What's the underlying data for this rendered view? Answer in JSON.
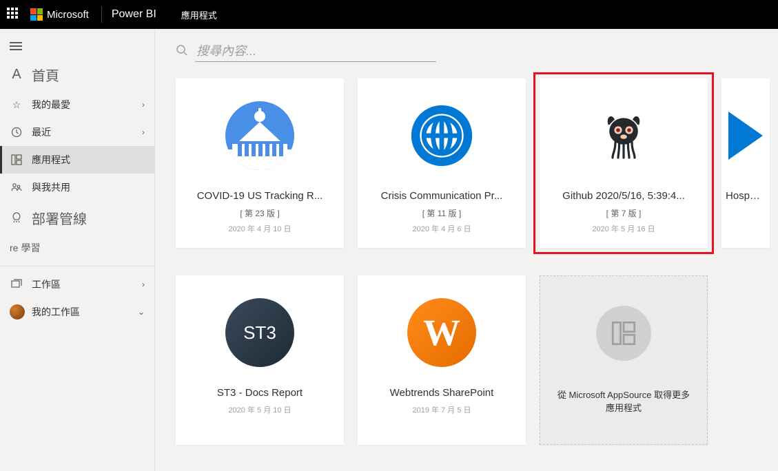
{
  "topbar": {
    "brand": "Microsoft",
    "product": "Power BI",
    "breadcrumb": "應用程式"
  },
  "sidebar": {
    "home": "首頁",
    "favorites": "我的最愛",
    "recent": "最近",
    "apps": "應用程式",
    "shared": "與我共用",
    "pipelines": "部署管線",
    "learn_prefix": "re",
    "learn": "學習",
    "workspaces": "工作區",
    "my_workspace": "我的工作區"
  },
  "search": {
    "placeholder": "搜尋內容..."
  },
  "cards": [
    {
      "title": "COVID-19 US Tracking R...",
      "version": "[ 第 23 版 ]",
      "date": "2020 年 4 月 10 日",
      "icon": "capitol"
    },
    {
      "title": "Crisis Communication Pr...",
      "version": "[ 第 11 版 ]",
      "date": "2020 年 4 月 6 日",
      "icon": "globe"
    },
    {
      "title": "Github 2020/5/16, 5:39:4...",
      "version": "[ 第 7 版 ]",
      "date": "2020 年 5 月 16 日",
      "icon": "octocat",
      "highlight": true
    },
    {
      "title": "Hospital",
      "icon": "hospital",
      "partial": true
    },
    {
      "title": "ST3 - Docs Report",
      "date": "2020 年 5 月 10 日",
      "icon": "st3"
    },
    {
      "title": "Webtrends SharePoint",
      "date": "2019 年 7 月 5 日",
      "icon": "webtrends"
    }
  ],
  "getmore": "從 Microsoft AppSource 取得更多應用程式"
}
